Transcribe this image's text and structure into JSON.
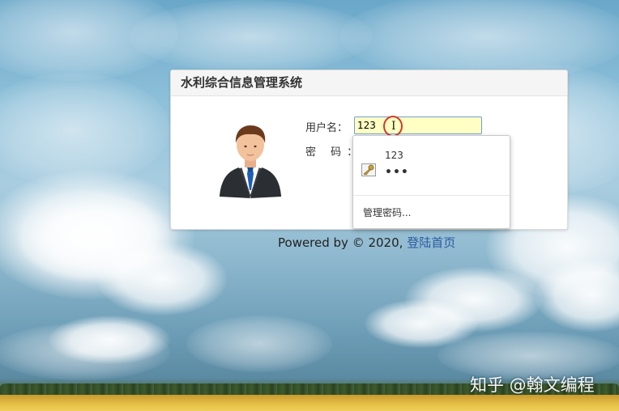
{
  "panel": {
    "title": "水利综合信息管理系统"
  },
  "form": {
    "username_label": "用户名：",
    "username_value": "123",
    "password_label": "密 码："
  },
  "autocomplete": {
    "saved_username": "123",
    "saved_password_mask": "•••",
    "manage_label": "管理密码..."
  },
  "footer": {
    "prefix": "Powered by © 2020, ",
    "link": "登陆首页"
  },
  "watermark": "知乎 @翰文编程",
  "icons": [
    "avatar-person-icon",
    "key-icon",
    "text-cursor-icon"
  ],
  "colors": {
    "input_highlight": "#ffffc4",
    "input_border": "#6f9fd8",
    "cursor_ring": "#d23a2a",
    "link": "#2c5aa0"
  }
}
